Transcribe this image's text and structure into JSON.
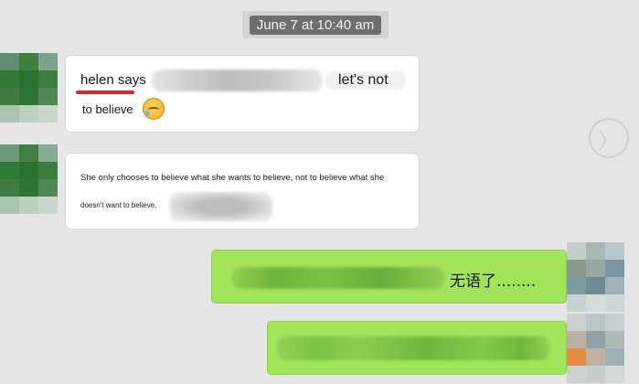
{
  "timestamp": "June 7 at 10:40 am",
  "messages": [
    {
      "sender_label": "helen says",
      "text_end": "let's not",
      "line2": "to believe"
    },
    {
      "line1": "She only chooses to believe what she wants to believe, not to believe what she",
      "line2": "doesn't want to believe,"
    },
    {
      "text": "无语了........"
    },
    {
      "text": ""
    }
  ],
  "icons": {
    "next": "chevron-right-circle-icon",
    "emoji": "laughing-crying-emoji-icon"
  },
  "colors": {
    "background": "#e6e6e6",
    "incoming_bubble": "#ffffff",
    "outgoing_bubble": "#a0e55a",
    "underline": "#e0242a",
    "timestamp_bg": "#6f6f6f"
  }
}
